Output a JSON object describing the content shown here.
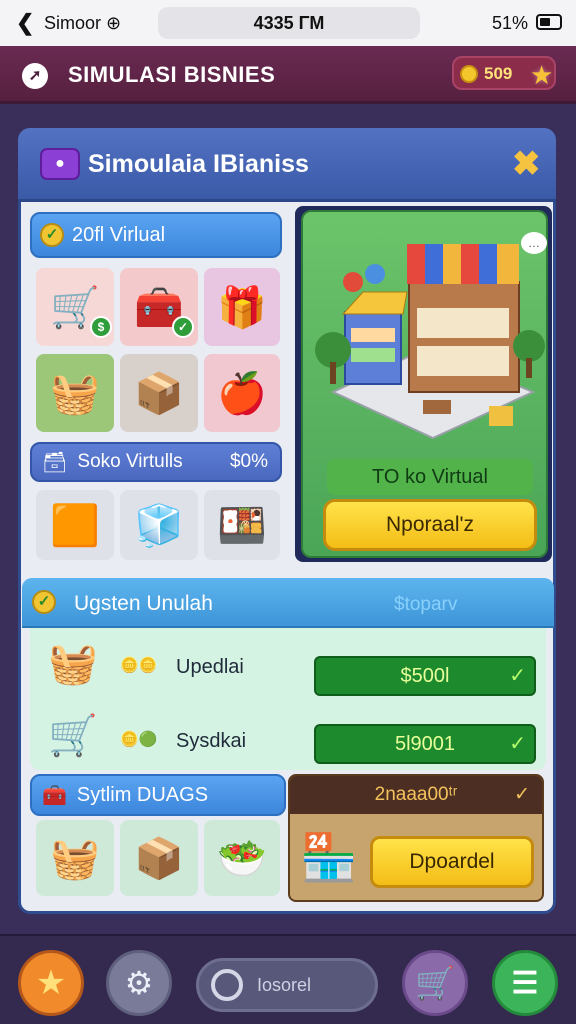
{
  "status_bar": {
    "back_icon": "chevron-left-icon",
    "carrier": "Simoor ⊕",
    "time": "4335 ΓM",
    "battery": "51%"
  },
  "header": {
    "title": "SIMULASI BISNIES",
    "coins": "509"
  },
  "panel": {
    "title": "Simoulaia IBianiss",
    "virtual_pill": "20fl Virlual",
    "toko_pill": "Soko Virtulls",
    "toko_pct": "$0%",
    "shop": {
      "label": "TO ko Virtual",
      "button": "Nporaal'z"
    }
  },
  "section2": {
    "title": "Ugsten Unulah",
    "right_text": "$toparv",
    "rows": [
      {
        "name": "Upedlai",
        "price": "$500l"
      },
      {
        "name": "Sysdkai",
        "price": "5l9001"
      }
    ]
  },
  "section3": {
    "pill": "Sytlim DUAGS",
    "header": "2naaa00ᵗʳ",
    "button": "Dpoardel"
  },
  "nav": {
    "search": "Iosorel"
  },
  "colors": {
    "header": "#5e2446",
    "panel_title": "#4566b6",
    "shop_bg": "#5cb560",
    "price": "#1d8a2e",
    "button": "#f6c525"
  }
}
